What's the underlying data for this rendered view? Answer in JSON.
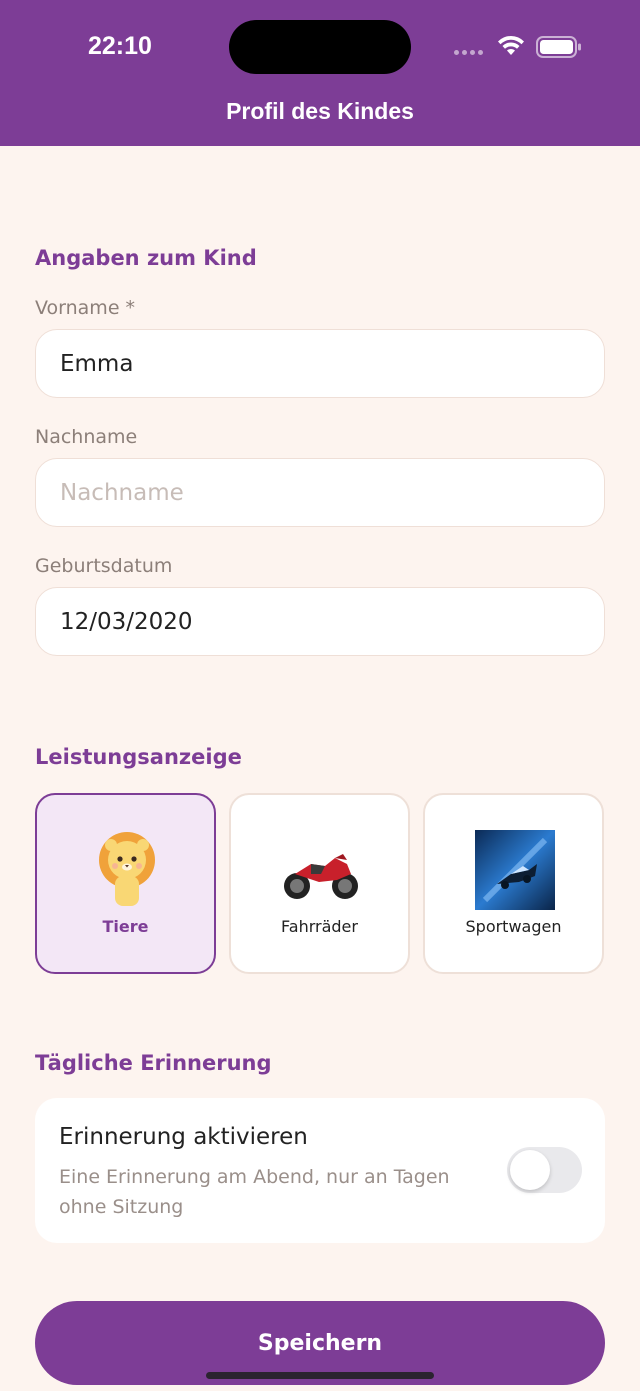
{
  "status_bar": {
    "time": "22:10"
  },
  "header": {
    "title": "Profil des Kindes"
  },
  "child_section": {
    "title": "Angaben zum Kind",
    "first_name": {
      "label": "Vorname *",
      "value": "Emma"
    },
    "last_name": {
      "label": "Nachname",
      "value": "",
      "placeholder": "Nachname"
    },
    "birth_date": {
      "label": "Geburtsdatum",
      "value": "12/03/2020"
    }
  },
  "display_section": {
    "title": "Leistungsanzeige",
    "options": [
      {
        "label": "Tiere",
        "icon": "lion-icon",
        "selected": true
      },
      {
        "label": "Fahrräder",
        "icon": "motorcycle-icon",
        "selected": false
      },
      {
        "label": "Sportwagen",
        "icon": "sportscar-icon",
        "selected": false
      }
    ]
  },
  "reminder_section": {
    "title": "Tägliche Erinnerung",
    "toggle_title": "Erinnerung aktivieren",
    "toggle_subtitle": "Eine Erinnerung am Abend, nur an Tagen ohne Sitzung",
    "enabled": false
  },
  "save_label": "Speichern",
  "colors": {
    "brand": "#7d3d96",
    "background": "#fdf4ef"
  }
}
